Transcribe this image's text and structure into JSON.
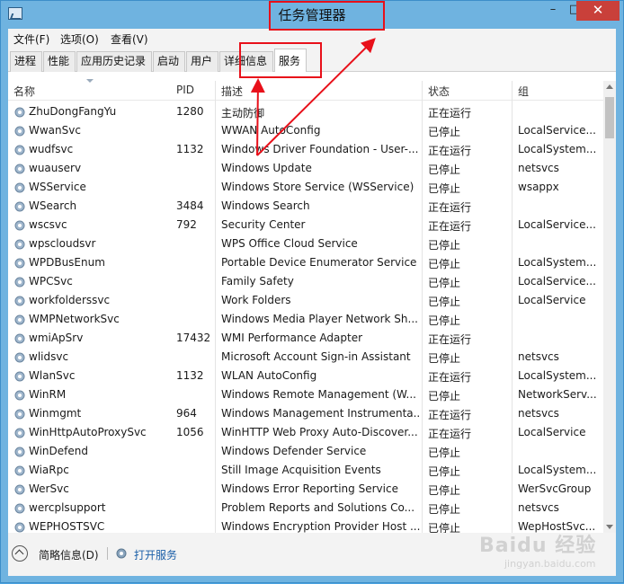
{
  "window": {
    "title": "任务管理器",
    "controls": {
      "minimize": "–",
      "maximize": "□",
      "close": "✕"
    }
  },
  "menu": [
    "文件(F)",
    "选项(O)",
    "查看(V)"
  ],
  "tabs": [
    "进程",
    "性能",
    "应用历史记录",
    "启动",
    "用户",
    "详细信息",
    "服务"
  ],
  "active_tab": "服务",
  "columns": {
    "name": "名称",
    "pid": "PID",
    "desc": "描述",
    "status": "状态",
    "group": "组"
  },
  "rows": [
    {
      "name": "ZhuDongFangYu",
      "pid": "1280",
      "desc": "主动防御",
      "status": "正在运行",
      "group": ""
    },
    {
      "name": "WwanSvc",
      "pid": "",
      "desc": "WWAN AutoConfig",
      "status": "已停止",
      "group": "LocalService..."
    },
    {
      "name": "wudfsvc",
      "pid": "1132",
      "desc": "Windows Driver Foundation - User-...",
      "status": "正在运行",
      "group": "LocalSystem..."
    },
    {
      "name": "wuauserv",
      "pid": "",
      "desc": "Windows Update",
      "status": "已停止",
      "group": "netsvcs"
    },
    {
      "name": "WSService",
      "pid": "",
      "desc": "Windows Store Service (WSService)",
      "status": "已停止",
      "group": "wsappx"
    },
    {
      "name": "WSearch",
      "pid": "3484",
      "desc": "Windows Search",
      "status": "正在运行",
      "group": ""
    },
    {
      "name": "wscsvc",
      "pid": "792",
      "desc": "Security Center",
      "status": "正在运行",
      "group": "LocalService..."
    },
    {
      "name": "wpscloudsvr",
      "pid": "",
      "desc": "WPS Office Cloud Service",
      "status": "已停止",
      "group": ""
    },
    {
      "name": "WPDBusEnum",
      "pid": "",
      "desc": "Portable Device Enumerator Service",
      "status": "已停止",
      "group": "LocalSystem..."
    },
    {
      "name": "WPCSvc",
      "pid": "",
      "desc": "Family Safety",
      "status": "已停止",
      "group": "LocalService..."
    },
    {
      "name": "workfolderssvc",
      "pid": "",
      "desc": "Work Folders",
      "status": "已停止",
      "group": "LocalService"
    },
    {
      "name": "WMPNetworkSvc",
      "pid": "",
      "desc": "Windows Media Player Network Sh...",
      "status": "已停止",
      "group": ""
    },
    {
      "name": "wmiApSrv",
      "pid": "17432",
      "desc": "WMI Performance Adapter",
      "status": "正在运行",
      "group": ""
    },
    {
      "name": "wlidsvc",
      "pid": "",
      "desc": "Microsoft Account Sign-in Assistant",
      "status": "已停止",
      "group": "netsvcs"
    },
    {
      "name": "WlanSvc",
      "pid": "1132",
      "desc": "WLAN AutoConfig",
      "status": "正在运行",
      "group": "LocalSystem..."
    },
    {
      "name": "WinRM",
      "pid": "",
      "desc": "Windows Remote Management (W...",
      "status": "已停止",
      "group": "NetworkServ..."
    },
    {
      "name": "Winmgmt",
      "pid": "964",
      "desc": "Windows Management Instrumenta...",
      "status": "正在运行",
      "group": "netsvcs"
    },
    {
      "name": "WinHttpAutoProxySvc",
      "pid": "1056",
      "desc": "WinHTTP Web Proxy Auto-Discover...",
      "status": "正在运行",
      "group": "LocalService"
    },
    {
      "name": "WinDefend",
      "pid": "",
      "desc": "Windows Defender Service",
      "status": "已停止",
      "group": ""
    },
    {
      "name": "WiaRpc",
      "pid": "",
      "desc": "Still Image Acquisition Events",
      "status": "已停止",
      "group": "LocalSystem..."
    },
    {
      "name": "WerSvc",
      "pid": "",
      "desc": "Windows Error Reporting Service",
      "status": "已停止",
      "group": "WerSvcGroup"
    },
    {
      "name": "wercplsupport",
      "pid": "",
      "desc": "Problem Reports and Solutions Co...",
      "status": "已停止",
      "group": "netsvcs"
    },
    {
      "name": "WEPHOSTSVC",
      "pid": "",
      "desc": "Windows Encryption Provider Host ...",
      "status": "已停止",
      "group": "WepHostSvc..."
    }
  ],
  "footer": {
    "less_details": "简略信息(D)",
    "open_services": "打开服务"
  },
  "watermark": {
    "main": "Baidu 经验",
    "sub": "jingyan.baidu.com"
  },
  "colors": {
    "annotation": "#e8101a",
    "titlebar": "#6fb3e0",
    "close": "#c9403a",
    "link": "#1b5fa8"
  }
}
